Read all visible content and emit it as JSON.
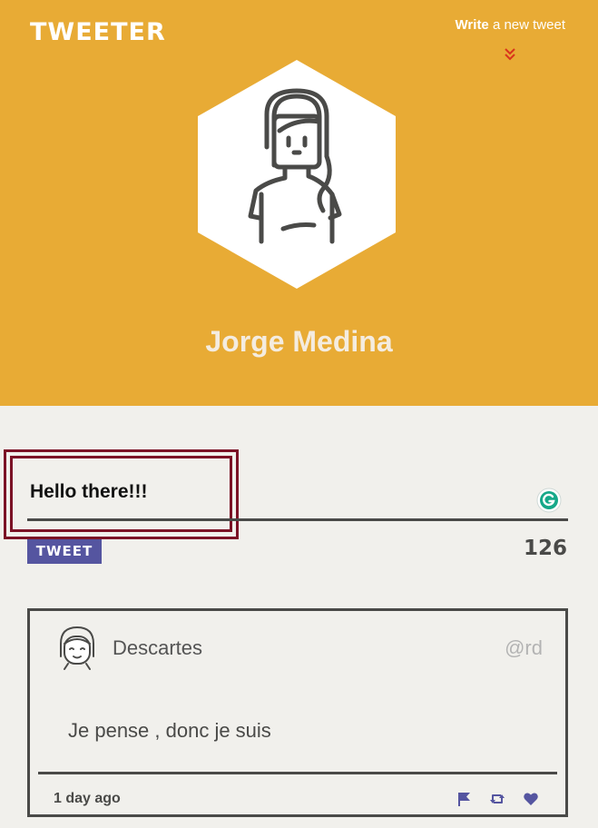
{
  "header": {
    "logo": "TWEETER",
    "write_bold": "Write",
    "write_rest": " a new tweet",
    "profile_name": "Jorge Medina"
  },
  "compose": {
    "text": "Hello there!!!",
    "button_label": "TWEET",
    "char_count": "126"
  },
  "tweets": [
    {
      "author": "Descartes",
      "handle": "@rd",
      "body": "Je pense , donc je suis",
      "time": "1 day ago"
    }
  ],
  "colors": {
    "header_bg": "#e8ab35",
    "page_bg": "#f1f0ec",
    "accent_purple": "#5555a0",
    "highlight": "#7b1226",
    "chevron": "#d9331c"
  }
}
